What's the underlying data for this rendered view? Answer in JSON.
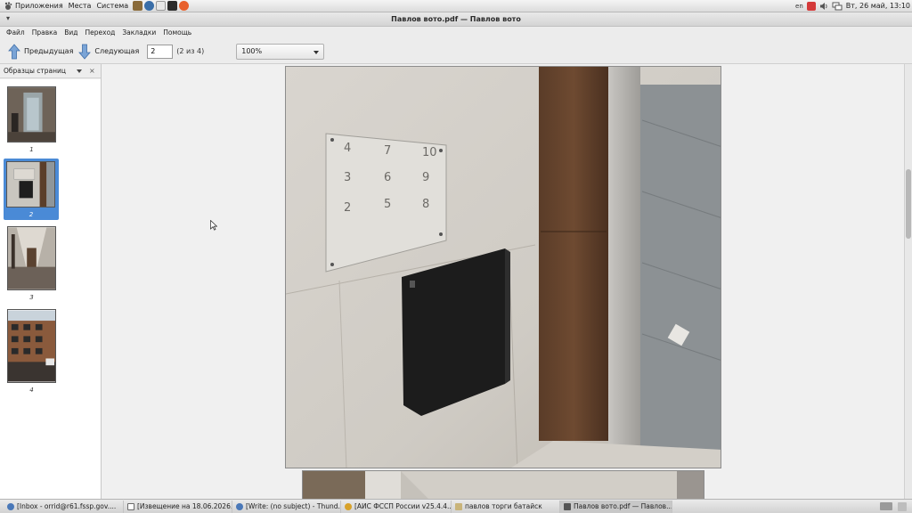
{
  "top_panel": {
    "menus": [
      "Приложения",
      "Места",
      "Система"
    ],
    "launchers": [
      {
        "name": "app-launcher-1",
        "color": "#8a6b3a"
      },
      {
        "name": "app-launcher-2",
        "color": "#3a6ea8"
      },
      {
        "name": "app-launcher-3",
        "color": "#e8e8e8"
      },
      {
        "name": "terminal-launcher",
        "color": "#2b2b2b"
      },
      {
        "name": "firefox-launcher",
        "color": "#e8602c"
      }
    ],
    "keyboard_layout": "en",
    "clock": "Вт, 26 май, 13:10"
  },
  "window": {
    "title": "Павлов вото.pdf — Павлов вото"
  },
  "menubar": {
    "items": [
      "Файл",
      "Правка",
      "Вид",
      "Переход",
      "Закладки",
      "Помощь"
    ]
  },
  "toolbar": {
    "prev_label": "Предыдущая",
    "next_label": "Следующая",
    "page_value": "2",
    "page_count": "(2 из 4)",
    "zoom_value": "100%"
  },
  "sidepane": {
    "header": "Образцы страниц",
    "thumbnails": [
      {
        "label": "1",
        "selected": false
      },
      {
        "label": "2",
        "selected": true
      },
      {
        "label": "3",
        "selected": false
      },
      {
        "label": "4",
        "selected": false
      }
    ]
  },
  "taskbar": {
    "tasks": [
      {
        "label": "[Inbox - orrid@r61.fssp.gov....",
        "icon": "thunderbird-icon",
        "color": "#4a78b8"
      },
      {
        "label": "[Извещение на 18.06.2026...",
        "icon": "document-icon",
        "color": "#6a6a6a"
      },
      {
        "label": "[Write: (no subject) - Thund...",
        "icon": "thunderbird-icon",
        "color": "#4a78b8"
      },
      {
        "label": "[АИС ФССП России v25.4.4...",
        "icon": "star-icon",
        "color": "#d8a22a"
      },
      {
        "label": "павлов торги батайск",
        "icon": "folder-icon",
        "color": "#c9b47a"
      },
      {
        "label": "Павлов вото.pdf — Павлов...",
        "icon": "document-viewer-icon",
        "color": "#555555",
        "active": true
      }
    ]
  },
  "colors": {
    "selection": "#4a8ad6",
    "panel": "#e4e4e4"
  }
}
